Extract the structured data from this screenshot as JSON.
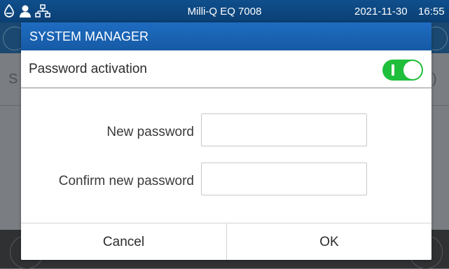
{
  "status_bar": {
    "title": "Milli-Q EQ 7008",
    "date": "2021-11-30",
    "time": "16:55",
    "icons": [
      "water-drop-icon",
      "user-icon",
      "network-icon"
    ]
  },
  "background": {
    "row_initial": "S",
    "row_trailing": ")"
  },
  "dialog": {
    "title": "SYSTEM MANAGER",
    "password_activation": {
      "label": "Password activation",
      "toggle_on": true,
      "toggle_color": "#1fbf3b"
    },
    "fields": {
      "new_password": {
        "label": "New password",
        "value": ""
      },
      "confirm_password": {
        "label": "Confirm new password",
        "value": ""
      }
    },
    "buttons": {
      "cancel": "Cancel",
      "ok": "OK"
    }
  },
  "colors": {
    "status_bar": "#0f4f8c",
    "header": "#1e6cc1",
    "overlay": "#7a7d81"
  }
}
